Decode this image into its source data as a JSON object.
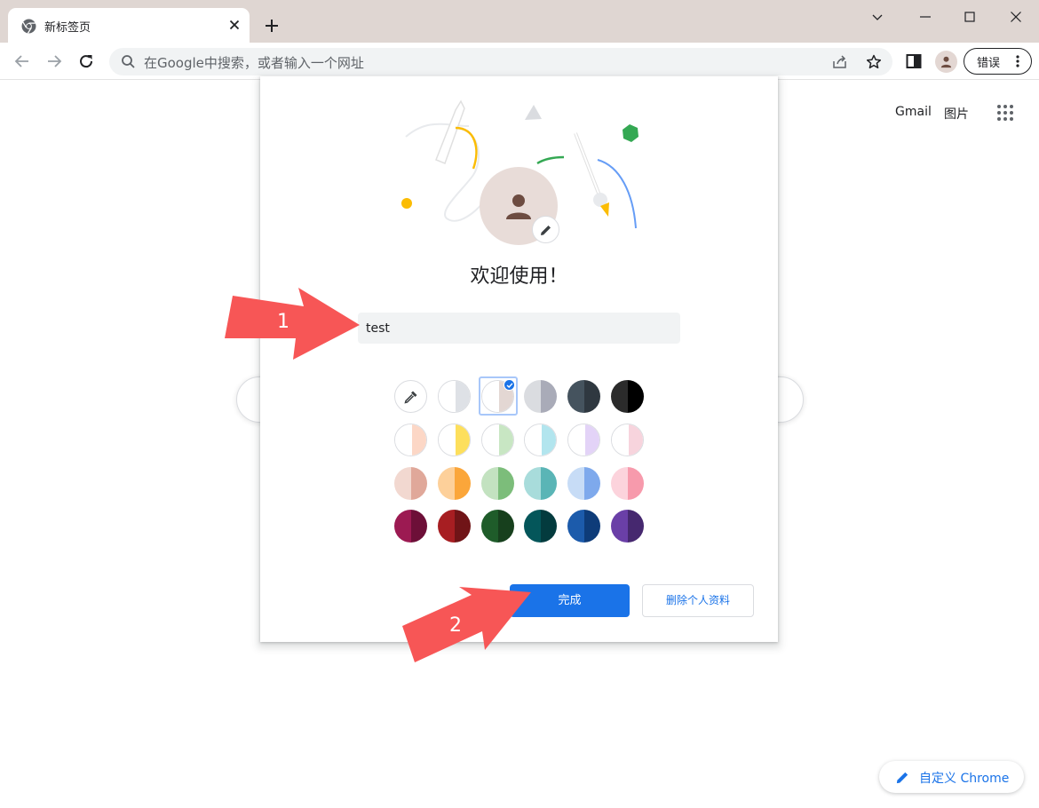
{
  "browser": {
    "tab_title": "新标签页",
    "omnibox_placeholder": "在Google中搜索，或者输入一个网址",
    "error_label": "错误"
  },
  "ntp": {
    "gmail_link": "Gmail",
    "images_link": "图片",
    "customize_label": "自定义 Chrome"
  },
  "dialog": {
    "welcome": "欢迎使用！",
    "name_value": "test",
    "done_label": "完成",
    "delete_label": "删除个人资料",
    "colors": [
      [
        {
          "l": "#ffffff",
          "r": "#dee1e6"
        },
        {
          "l": "#ffffff",
          "r": "#e3d7d3",
          "selected": true
        },
        {
          "l": "#dadce0",
          "r": "#a9abb8"
        },
        {
          "l": "#45535e",
          "r": "#2f3840"
        },
        {
          "l": "#2b2b2b",
          "r": "#000000"
        }
      ],
      [
        {
          "l": "#ffffff",
          "r": "#fcd7c6"
        },
        {
          "l": "#ffffff",
          "r": "#fddf5c"
        },
        {
          "l": "#ffffff",
          "r": "#c8e6c3"
        },
        {
          "l": "#ffffff",
          "r": "#b2e5ee"
        },
        {
          "l": "#ffffff",
          "r": "#e3d3f7"
        },
        {
          "l": "#ffffff",
          "r": "#f7d4dd"
        }
      ],
      [
        {
          "l": "#f2d8d0",
          "r": "#e0a89a"
        },
        {
          "l": "#fdd09a",
          "r": "#fba63a"
        },
        {
          "l": "#c3e2c0",
          "r": "#7cbd7a"
        },
        {
          "l": "#a8dcdb",
          "r": "#5ab5b6"
        },
        {
          "l": "#c7dcf6",
          "r": "#7ea9ec"
        },
        {
          "l": "#fcd3dc",
          "r": "#f79aac"
        }
      ],
      [
        {
          "l": "#9c1a52",
          "r": "#6d0f38"
        },
        {
          "l": "#a71e22",
          "r": "#701417"
        },
        {
          "l": "#1f5c2a",
          "r": "#17401d"
        },
        {
          "l": "#04565a",
          "r": "#033b3e"
        },
        {
          "l": "#1c5bab",
          "r": "#0e3c79"
        },
        {
          "l": "#6a3fa7",
          "r": "#46286f"
        }
      ]
    ]
  },
  "annotations": {
    "arrow1_label": "1",
    "arrow2_label": "2",
    "arrow_color": "#f75656"
  }
}
